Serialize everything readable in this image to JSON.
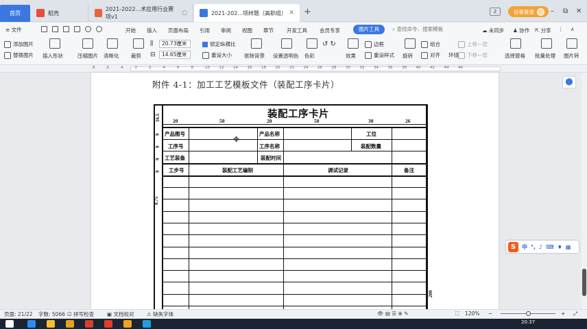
{
  "tabs": {
    "home": "首页",
    "items": [
      {
        "label": "稻壳",
        "icon_color": "#e84c3d"
      },
      {
        "label": "2021-2022...术应用行业赛项v1",
        "icon_color": "#e9643b"
      },
      {
        "label": "2021-202...项样题（高职组）",
        "icon_color": "#3a78e0"
      }
    ],
    "add": "+"
  },
  "titlebar": {
    "badge": "2",
    "login": "访客登录",
    "minimize": "–",
    "restore": "⧉",
    "close": "✕"
  },
  "menu": {
    "file": "≡ 文件",
    "items": [
      "开始",
      "插入",
      "页面布局",
      "引用",
      "审阅",
      "视图",
      "章节",
      "开发工具",
      "会员专享"
    ],
    "active_tab": "图片工具",
    "search": "查找命令、搜索模板",
    "sync": "未同步",
    "collab": "协作",
    "share": "分享"
  },
  "ribbon": {
    "add_picture": "添加图片",
    "replace_picture": "替换图片",
    "insert_shape": "插入形状",
    "compress_picture": "压缩图片",
    "clarity": "清晰化",
    "crop": "裁剪",
    "width_value": "20.73厘米",
    "height_value": "14.65厘米",
    "lock_ratio": "锁定纵横比",
    "reset_size": "重设大小",
    "remove_bg": "抠除背景",
    "set_transparent": "设置透明色",
    "color": "色彩",
    "effects": "效果",
    "reset_style": "重设样式",
    "border": "边框",
    "rotate": "旋转",
    "combine": "组合",
    "align": "对齐",
    "move_up": "上移一层",
    "move_down": "下移一层",
    "wrap": "环绕",
    "select_pane": "选择窗格",
    "batch": "批量处理",
    "to_picture": "图片转"
  },
  "ruler": {
    "ticks": [
      "8",
      "6",
      "4",
      "2",
      "2",
      "4",
      "6",
      "8",
      "10",
      "12",
      "14",
      "16",
      "18",
      "20",
      "22",
      "24",
      "26",
      "28",
      "30",
      "32",
      "34",
      "36",
      "38",
      "40",
      "42",
      "44",
      "46"
    ]
  },
  "document": {
    "heading": "附件 4-1：加工工艺模板文件（装配工序卡片）",
    "card": {
      "title": "装配工序卡片",
      "col_dims": [
        "20",
        "50",
        "20",
        "50",
        "30",
        "26"
      ],
      "row_dims": [
        "16.5",
        "9",
        "9",
        "9",
        "9"
      ],
      "side_dim": "8.75",
      "side_dim_right": "200",
      "row1": {
        "a": "产品图号",
        "b": "产品名称",
        "c": "工位"
      },
      "row2": {
        "a": "工序号",
        "b": "工序名称",
        "c": "装配数量"
      },
      "row3": {
        "a": "工艺装备",
        "b": "装配时间"
      },
      "header": {
        "step": "工步号",
        "process": "装配工艺编制",
        "record": "调试记录",
        "remark": "备注"
      }
    }
  },
  "status": {
    "page": "页面: 21/22",
    "words": "字数: 5066",
    "spell": "拼写检查",
    "proof": "文档校对",
    "missing_font": "缺失字体",
    "zoom": "120%"
  },
  "ime": {
    "logo": "S",
    "text": "中"
  },
  "taskbar": {
    "clock": "20:37",
    "icons": [
      "#2c8cf3",
      "#f2c12e",
      "#e6a11f",
      "#d6412f",
      "#e33c2b",
      "#f4a11d",
      "#1fa0e0"
    ]
  }
}
